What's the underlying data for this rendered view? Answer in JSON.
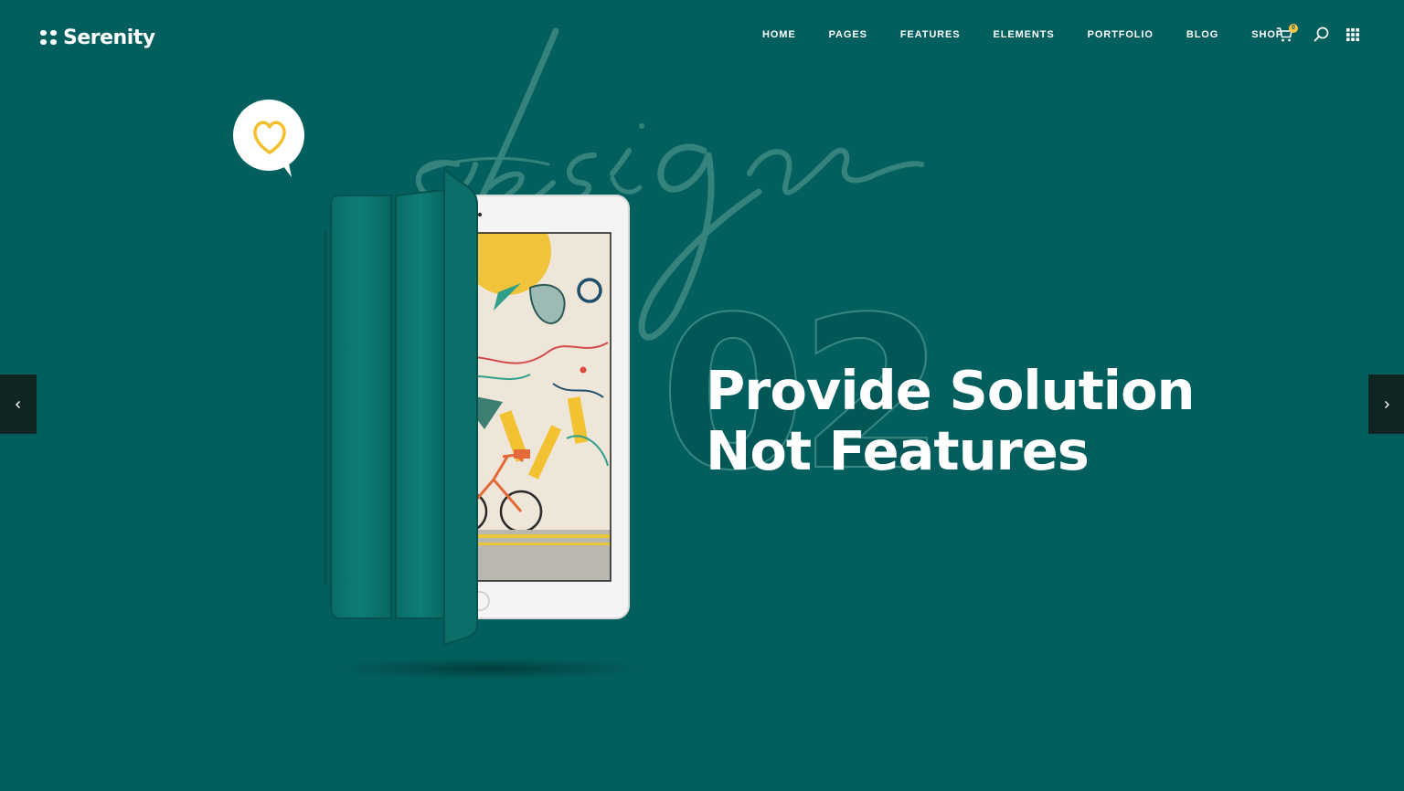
{
  "header": {
    "logo_text": "Serenity",
    "nav": [
      {
        "label": "HOME"
      },
      {
        "label": "PAGES"
      },
      {
        "label": "FEATURES"
      },
      {
        "label": "ELEMENTS"
      },
      {
        "label": "PORTFOLIO"
      },
      {
        "label": "BLOG"
      },
      {
        "label": "SHOP"
      }
    ],
    "cart_count": "0",
    "icons": [
      "cart-icon",
      "search-icon",
      "grid-menu-icon"
    ]
  },
  "hero": {
    "script_word": "design",
    "slide_number": "02",
    "title_line1": "Provide Solution",
    "title_line2": "Not Features"
  },
  "slider": {
    "prev_icon": "chevron-left-icon",
    "next_icon": "chevron-right-icon"
  },
  "colors": {
    "background": "#025f5d",
    "accent": "#f6c342",
    "arrow_bg": "#0f2522",
    "text": "#ffffff"
  }
}
